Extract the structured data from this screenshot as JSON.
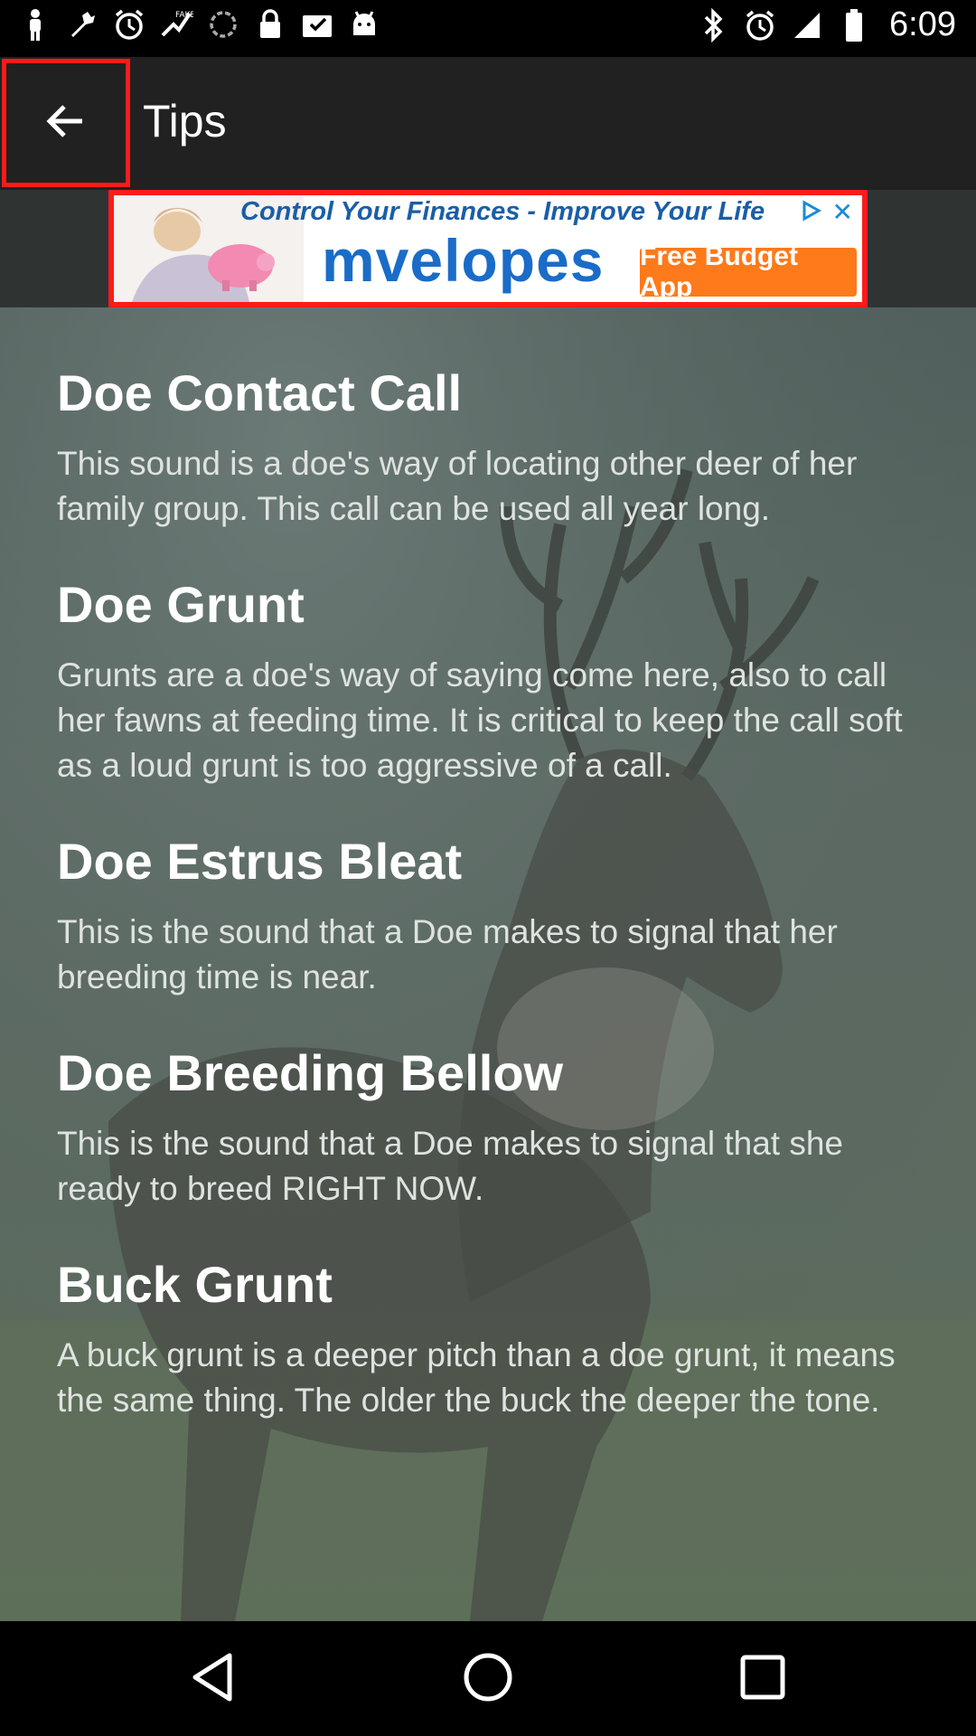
{
  "status_bar": {
    "time": "6:09",
    "left_icons": [
      "person-icon",
      "wrench-icon",
      "alarm-icon",
      "fake-gps-icon",
      "sync-icon",
      "lock-icon",
      "inbox-icon",
      "android-icon"
    ],
    "right_icons": [
      "bluetooth-icon",
      "alarm-icon"
    ]
  },
  "app_bar": {
    "title": "Tips",
    "back_icon": "arrow-left-icon"
  },
  "ad": {
    "headline": "Control Your Finances - Improve Your Life",
    "brand": "mvelopes",
    "cta": "Free Budget App"
  },
  "tips": [
    {
      "title": "Doe Contact Call",
      "body": "This sound is a doe's way of locating other deer of her family group. This call can be used all year long."
    },
    {
      "title": "Doe Grunt",
      "body": "Grunts are a doe's way of saying come here, also to call her fawns at feeding time. It is critical to keep the call soft as a loud grunt is too aggressive of a call."
    },
    {
      "title": "Doe Estrus Bleat",
      "body": "This is the sound that a Doe makes to signal that her breeding time is near."
    },
    {
      "title": "Doe Breeding Bellow",
      "body": "This is the sound that a Doe makes to signal that she ready to breed RIGHT NOW."
    },
    {
      "title": "Buck Grunt",
      "body": "A buck grunt is a deeper pitch than a doe grunt, it means the same thing. The older the buck the deeper the tone."
    }
  ],
  "nav_bar": {
    "icons": [
      "back-triangle-icon",
      "home-circle-icon",
      "recents-square-icon"
    ]
  },
  "colors": {
    "highlight": "#ff1a1a",
    "app_bar": "#212121",
    "ad_cta": "#ff7a1a",
    "ad_brand": "#1a6cc8"
  }
}
